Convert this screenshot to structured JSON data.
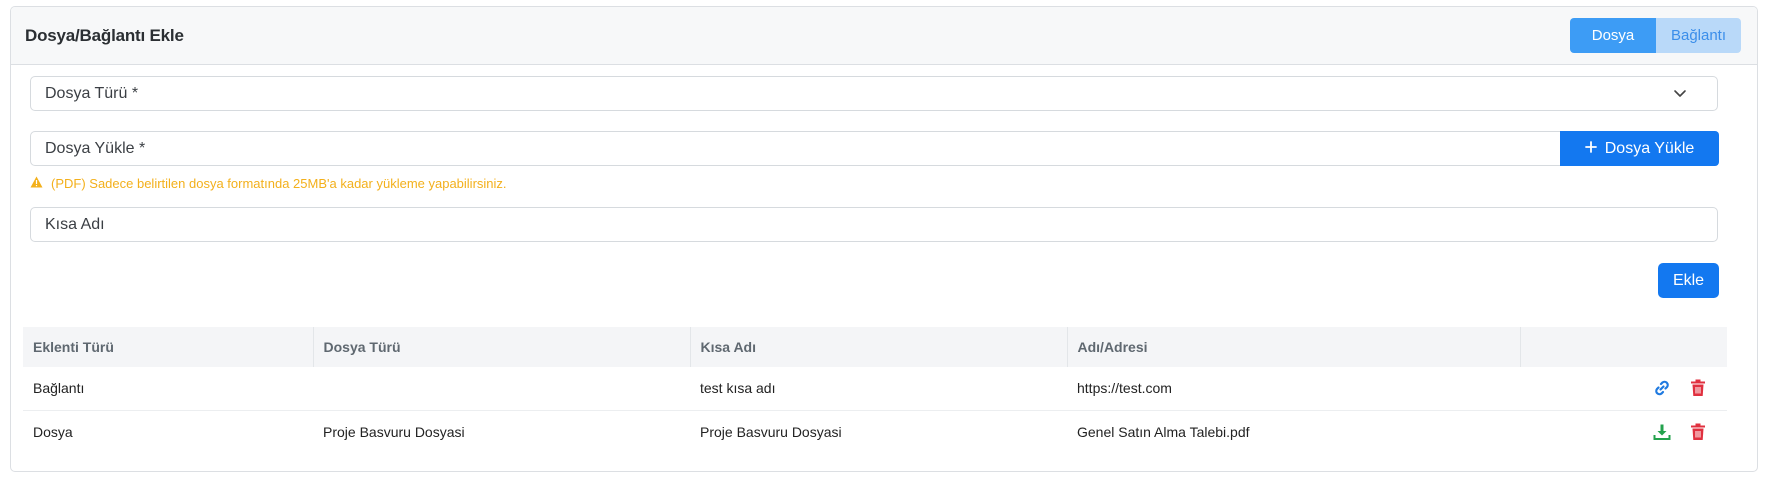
{
  "header": {
    "title": "Dosya/Bağlantı Ekle",
    "toggle": {
      "options": [
        "Dosya",
        "Bağlantı"
      ],
      "selected": "Dosya"
    }
  },
  "form": {
    "file_type": {
      "placeholder": "Dosya Türü *",
      "icon": "chevron-down-icon"
    },
    "file_upload": {
      "placeholder": "Dosya Yükle *",
      "button_label": "Dosya Yükle",
      "button_icon": "plus-icon"
    },
    "warning": {
      "text": "(PDF) Sadece belirtilen dosya formatında 25MB'a kadar yükleme yapabilirsiniz.",
      "icon": "warning-icon",
      "color": "#f3b01c"
    },
    "short_name": {
      "placeholder": "Kısa Adı"
    },
    "add_label": "Ekle"
  },
  "table": {
    "headers": [
      "Eklenti Türü",
      "Dosya Türü",
      "Kısa Adı",
      "Adı/Adresi",
      ""
    ],
    "rows": [
      {
        "type": "Bağlantı",
        "file_type": "",
        "short_name": "test kısa adı",
        "address": "https://test.com",
        "action_icon": "link-icon",
        "delete_icon": "trash-icon"
      },
      {
        "type": "Dosya",
        "file_type": "Proje Basvuru Dosyasi",
        "short_name": "Proje Basvuru Dosyasi",
        "address": "Genel Satın Alma Talebi.pdf",
        "action_icon": "download-icon",
        "delete_icon": "trash-icon"
      }
    ]
  },
  "colors": {
    "primary": "#1378f0",
    "toggle_active": "#3d9cf5",
    "toggle_inactive": "#b9d9f9",
    "danger": "#e0303f",
    "success": "#23a24d",
    "link": "#1f7ae0"
  }
}
